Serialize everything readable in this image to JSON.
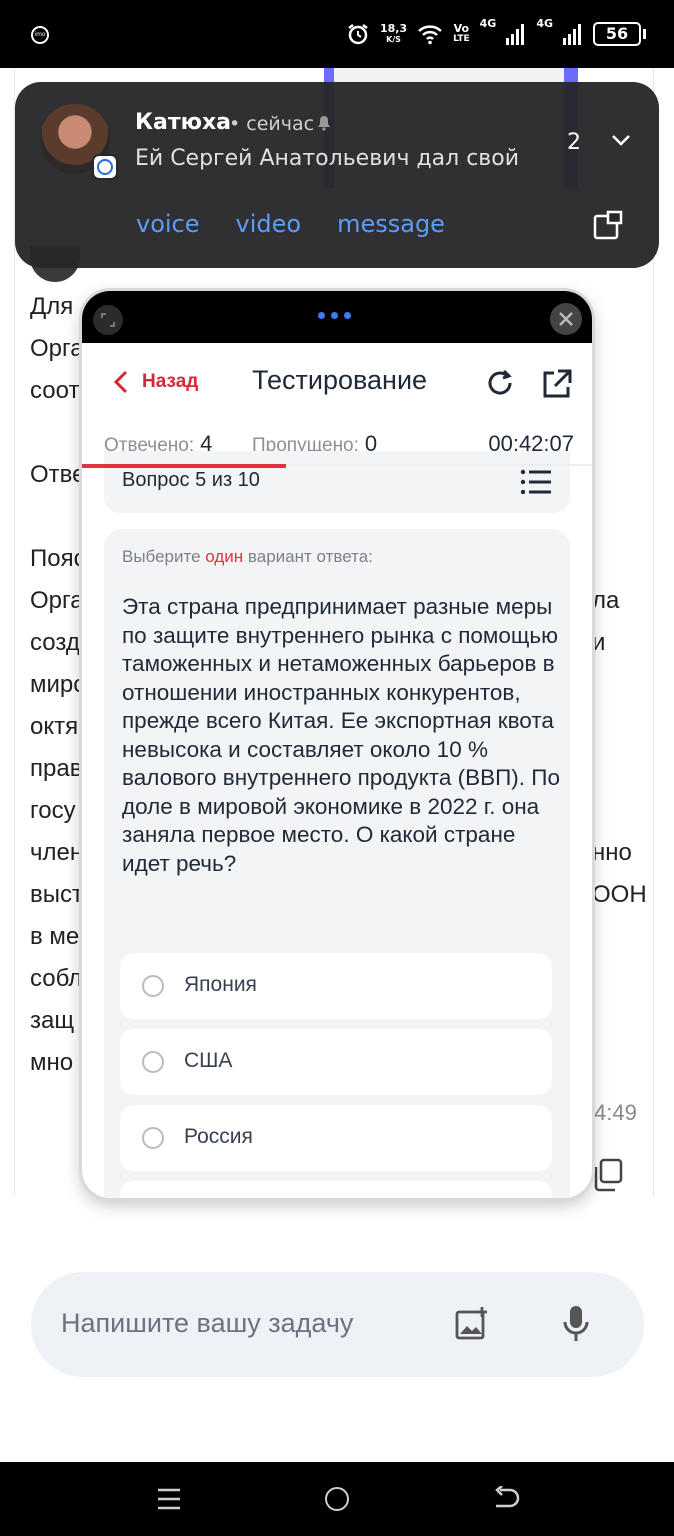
{
  "status_bar": {
    "net_speed_value": "18,3",
    "net_speed_unit": "K/S",
    "volte_top": "Vo",
    "volte_bottom": "LTE",
    "signal1": "4G",
    "signal2": "4G",
    "battery": "56"
  },
  "notification": {
    "sender": "Катюха",
    "time": "• сейчас",
    "preview": "Ей Сергей Анатольевич дал свой",
    "count": "2",
    "actions": [
      "voice",
      "video",
      "message"
    ]
  },
  "background_chat": {
    "left_fragments": [
      "Для",
      "Орга",
      "соот",
      "Отве",
      "Пояс",
      "Орга",
      "созд",
      "мирс",
      "октя",
      "прав",
      "госу",
      "член",
      "выст",
      "в ме",
      "собл",
      "защ",
      "мно"
    ],
    "right_fragments": [
      "ла",
      "и",
      "нно",
      "ООН"
    ],
    "time": "4:49"
  },
  "test_window": {
    "back_label": "Назад",
    "title": "Тестирование",
    "answered_label": "Отвечено:",
    "answered_value": "4",
    "skipped_label": "Пропущено:",
    "skipped_value": "0",
    "timer": "00:42:07",
    "progress_fraction": 0.4,
    "question_number": "Вопрос 5 из 10",
    "hint_before": "Выберите ",
    "hint_highlight": "один",
    "hint_after": " вариант ответа:",
    "question_text": "Эта страна предпринимает разные меры по защите внутреннего рынка с помощью таможенных и нетаможенных барьеров в отношении иностранных конкурентов, прежде всего Китая. Ее экспортная квота невысока и составляет около 10 % валового внутреннего продукта (ВВП). По доле в мировой экономике в 2022 г. она заняла первое место. О какой стране идет речь?",
    "options": [
      "Япония",
      "США",
      "Россия"
    ],
    "accent_color": "#e0323f"
  },
  "input": {
    "placeholder": "Напишите вашу задачу"
  }
}
